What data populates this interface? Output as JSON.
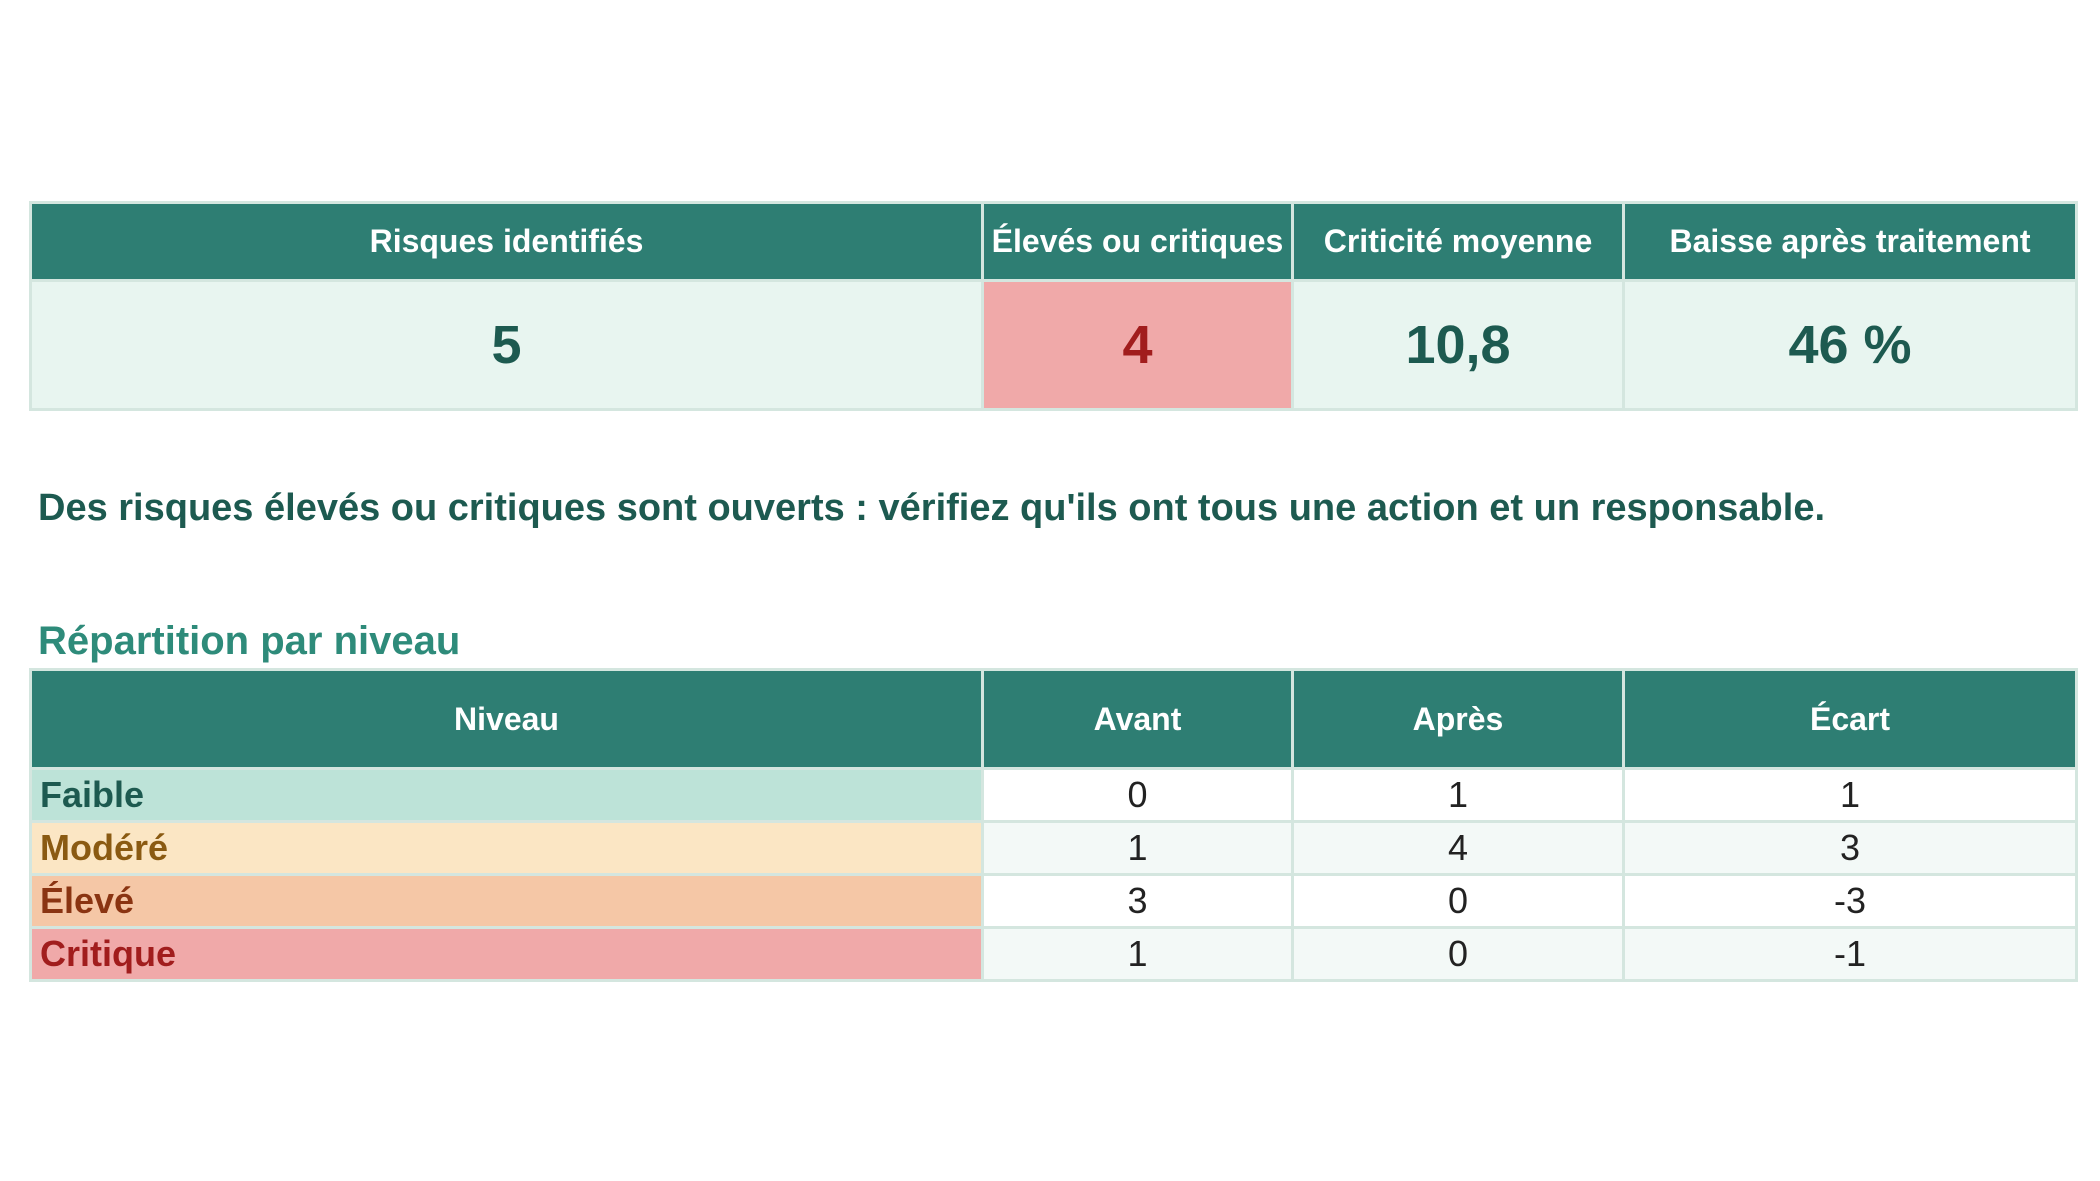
{
  "kpis": [
    {
      "label": "Risques identifiés",
      "value": "5"
    },
    {
      "label": "Élevés ou critiques",
      "value": "4"
    },
    {
      "label": "Criticité moyenne",
      "value": "10,8"
    },
    {
      "label": "Baisse après traitement",
      "value": "46 %"
    }
  ],
  "alert_message": "Des risques élevés ou critiques sont ouverts : vérifiez qu'ils ont tous une action et un responsable.",
  "distribution": {
    "title": "Répartition par niveau",
    "headers": [
      "Niveau",
      "Avant",
      "Après",
      "Écart"
    ],
    "rows": [
      {
        "level": "Faible",
        "before": "0",
        "after": "1",
        "diff": "1",
        "bg": "#bde3d8",
        "fg": "#1d5a50"
      },
      {
        "level": "Modéré",
        "before": "1",
        "after": "4",
        "diff": "3",
        "bg": "#fbe6c4",
        "fg": "#8a5a12"
      },
      {
        "level": "Élevé",
        "before": "3",
        "after": "0",
        "diff": "-3",
        "bg": "#f5c7a6",
        "fg": "#8a3412"
      },
      {
        "level": "Critique",
        "before": "1",
        "after": "0",
        "diff": "-1",
        "bg": "#f0a9a9",
        "fg": "#a11d1d"
      }
    ]
  },
  "colors": {
    "header_bg": "#2e7e73",
    "kpi_bg": "#e8f5f0",
    "alert_bg": "#f0a9a9",
    "alert_fg": "#a11d1d",
    "text_dark": "#1d5a50"
  }
}
